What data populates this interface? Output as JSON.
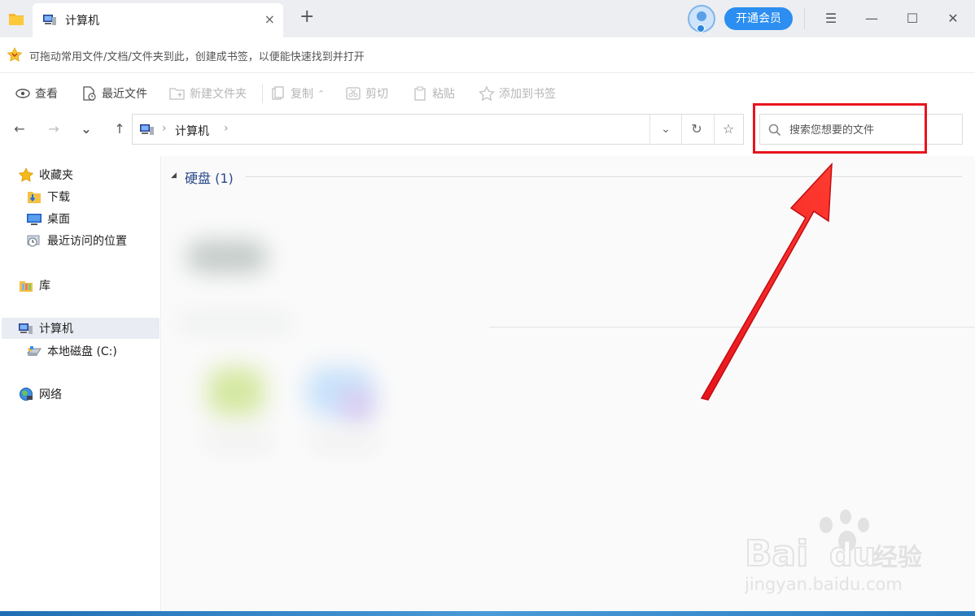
{
  "titlebar": {
    "tab_title": "计算机",
    "close_glyph": "×",
    "new_tab_glyph": "+",
    "vip_button": "开通会员",
    "menu_glyph": "☰",
    "minimize_glyph": "—",
    "maximize_glyph": "☐",
    "close_window_glyph": "✕"
  },
  "bookmark_bar": {
    "hint": "可拖动常用文件/文档/文件夹到此，创建成书签，以便能快速找到并打开"
  },
  "toolbar": {
    "view": "查看",
    "recent": "最近文件",
    "new_folder": "新建文件夹",
    "copy": "复制",
    "cut": "剪切",
    "paste": "粘贴",
    "add_bookmark": "添加到书签"
  },
  "nav": {
    "back": "←",
    "forward": "→",
    "history": "⌄",
    "up": "↑",
    "address": "计算机",
    "chevron": "›",
    "dropdown": "⌄",
    "refresh": "↻",
    "bookmark": "☆"
  },
  "search": {
    "placeholder": "搜索您想要的文件"
  },
  "sidebar": {
    "favorites": "收藏夹",
    "downloads": "下载",
    "desktop": "桌面",
    "recent_places": "最近访问的位置",
    "library": "库",
    "computer": "计算机",
    "local_disk": "本地磁盘 (C:)",
    "network": "网络"
  },
  "content": {
    "group_arrow": "◢",
    "group_title": "硬盘 (1)"
  },
  "watermark": {
    "brand": "Baidu经验",
    "url": "jingyan.baidu.com"
  },
  "colors": {
    "accent": "#2b8ef0",
    "highlight": "#e8141c",
    "arrow": "#e8141c"
  }
}
